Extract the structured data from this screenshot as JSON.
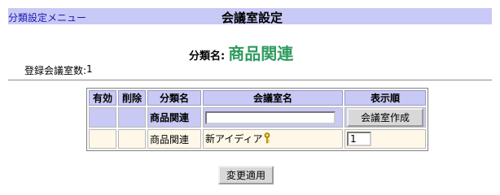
{
  "header": {
    "menu_link": "分類設定メニュー",
    "title": "会議室設定"
  },
  "category": {
    "label": "分類名:",
    "name": "商品関連"
  },
  "room_count": {
    "label": "登録会議室数:",
    "value": "1"
  },
  "table": {
    "headers": {
      "valid": "有効",
      "delete": "削除",
      "category": "分類名",
      "room": "会議室名",
      "order": "表示順"
    },
    "new_row": {
      "category": "商品関連",
      "room_input_value": "",
      "create_button": "会議室作成"
    },
    "rows": [
      {
        "valid": "",
        "delete": "",
        "category": "商品関連",
        "room": "新アイディア",
        "order": "1"
      }
    ]
  },
  "apply_button": "変更適用",
  "icons": {
    "room_key": "key-icon"
  },
  "colors": {
    "header_bg": "#c9c9f5",
    "category_name": "#2e9b5f",
    "row_bg": "#fff8e8",
    "link": "#1a1ab0"
  }
}
